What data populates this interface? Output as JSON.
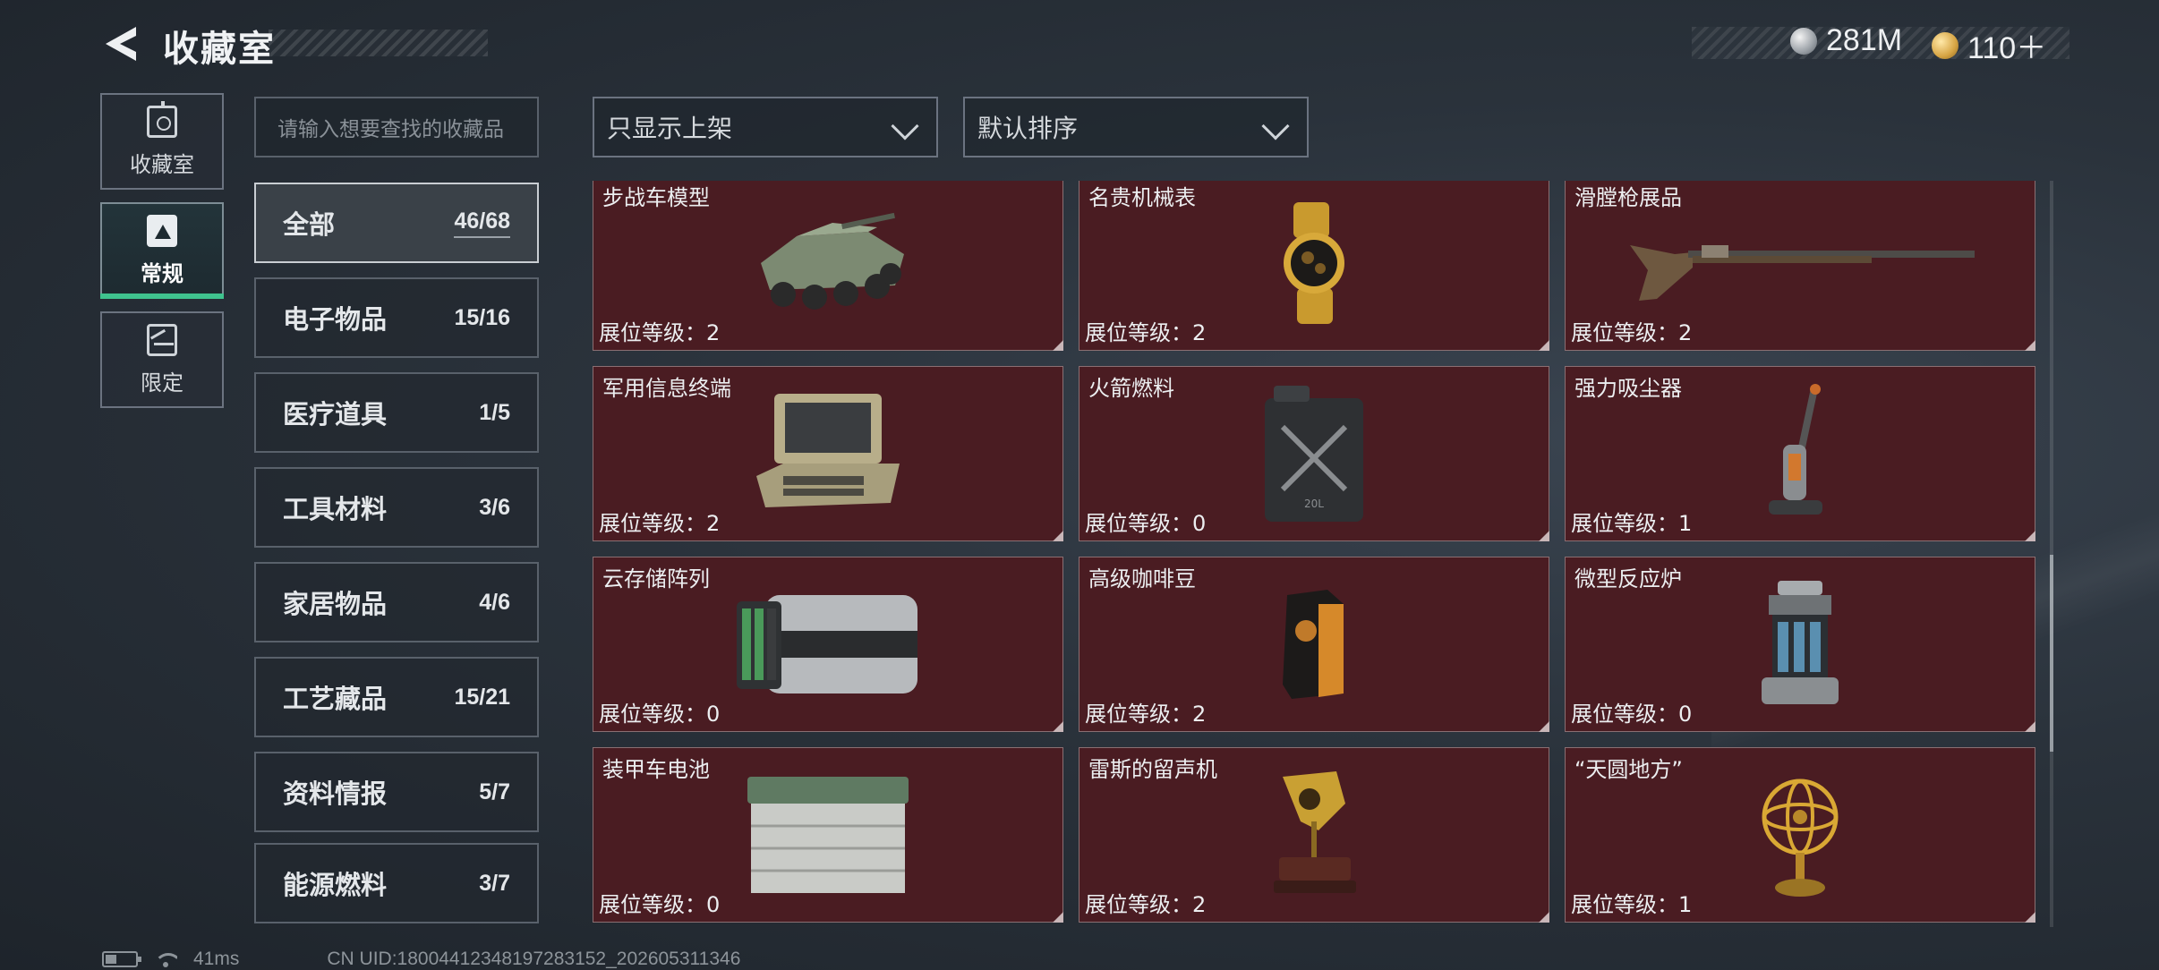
{
  "header": {
    "title": "收藏室",
    "currencies": [
      {
        "icon": "silver-coin-icon",
        "value": "281M"
      },
      {
        "icon": "gold-coin-icon",
        "value": "110＋"
      }
    ]
  },
  "side_tabs": [
    {
      "label": "收藏室",
      "icon": "vault-icon",
      "active": false
    },
    {
      "label": "常规",
      "icon": "document-icon",
      "active": true
    },
    {
      "label": "限定",
      "icon": "limited-icon",
      "active": false
    }
  ],
  "search": {
    "placeholder": "请输入想要查找的收藏品"
  },
  "filters": {
    "display": "只显示上架",
    "sort": "默认排序"
  },
  "categories": [
    {
      "name": "全部",
      "count": "46/68",
      "active": true
    },
    {
      "name": "电子物品",
      "count": "15/16"
    },
    {
      "name": "医疗道具",
      "count": "1/5"
    },
    {
      "name": "工具材料",
      "count": "3/6"
    },
    {
      "name": "家居物品",
      "count": "4/6"
    },
    {
      "name": "工艺藏品",
      "count": "15/21"
    },
    {
      "name": "资料情报",
      "count": "5/7"
    },
    {
      "name": "能源燃料",
      "count": "3/7"
    }
  ],
  "items": [
    {
      "name": "步战车模型",
      "level": "展位等级：2",
      "icon": "armored-vehicle-model-icon"
    },
    {
      "name": "名贵机械表",
      "level": "展位等级：2",
      "icon": "luxury-watch-icon"
    },
    {
      "name": "滑膛枪展品",
      "level": "展位等级：2",
      "icon": "musket-icon"
    },
    {
      "name": "军用信息终端",
      "level": "展位等级：2",
      "icon": "military-terminal-icon"
    },
    {
      "name": "火箭燃料",
      "level": "展位等级：0",
      "icon": "fuel-canister-icon"
    },
    {
      "name": "强力吸尘器",
      "level": "展位等级：1",
      "icon": "vacuum-cleaner-icon"
    },
    {
      "name": "云存储阵列",
      "level": "展位等级：0",
      "icon": "storage-array-icon"
    },
    {
      "name": "高级咖啡豆",
      "level": "展位等级：2",
      "icon": "coffee-bag-icon"
    },
    {
      "name": "微型反应炉",
      "level": "展位等级：0",
      "icon": "mini-reactor-icon"
    },
    {
      "name": "装甲车电池",
      "level": "展位等级：0",
      "icon": "vehicle-battery-icon"
    },
    {
      "name": "雷斯的留声机",
      "level": "展位等级：2",
      "icon": "gramophone-icon"
    },
    {
      "name": "“天圆地方”",
      "level": "展位等级：1",
      "icon": "armillary-sphere-icon"
    }
  ],
  "footer": {
    "latency": "41ms",
    "uid": "CN UID:180044123481972831​52_202605311346"
  }
}
